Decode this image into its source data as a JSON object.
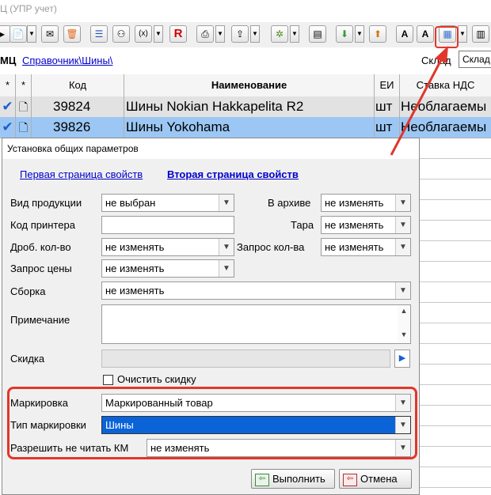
{
  "window": {
    "title": "Ц (УПР учет)"
  },
  "breadcrumb": {
    "lead": "МЦ",
    "path": "Справочник\\Шины\\"
  },
  "warehouse": {
    "label": "Склад",
    "value": "Склад"
  },
  "grid": {
    "headers": [
      "*",
      "*",
      "Код",
      "Наименование",
      "ЕИ",
      "Ставка НДС"
    ],
    "rows": [
      {
        "code": "39824",
        "name": "Шины Nokian Hakkapelita R2",
        "unit": "шт",
        "vat": "Необлагаемы"
      },
      {
        "code": "39826",
        "name": "Шины Yokohama",
        "unit": "шт",
        "vat": "Необлагаемы"
      }
    ]
  },
  "dialog": {
    "title": "Установка общих параметров",
    "tabs": [
      "Первая страница свойств",
      "Вторая страница свойств"
    ],
    "fields": {
      "product_type": {
        "label": "Вид продукции",
        "value": "не выбран"
      },
      "archive": {
        "label": "В архиве",
        "value": "не изменять"
      },
      "printer_code": {
        "label": "Код принтера",
        "value": ""
      },
      "tara": {
        "label": "Тара",
        "value": "не изменять"
      },
      "fractional_qty": {
        "label": "Дроб. кол-во",
        "value": "не изменять"
      },
      "ask_qty": {
        "label": "Запрос кол-ва",
        "value": "не изменять"
      },
      "ask_price": {
        "label": "Запрос цены",
        "value": "не изменять"
      },
      "assembly": {
        "label": "Сборка",
        "value": "не изменять"
      },
      "note": {
        "label": "Примечание",
        "value": ""
      },
      "discount": {
        "label": "Скидка",
        "value": ""
      },
      "clear_discount": {
        "label": "Очистить скидку",
        "checked": false
      },
      "marking": {
        "label": "Маркировка",
        "value": "Маркированный товар"
      },
      "marking_type": {
        "label": "Тип маркировки",
        "value": "Шины"
      },
      "allow_no_km": {
        "label": "Разрешить не читать КМ",
        "value": "не изменять"
      }
    },
    "buttons": {
      "execute": "Выполнить",
      "cancel": "Отмена"
    }
  },
  "colors": {
    "highlight": "#e2362b",
    "selected_row": "#9cc7f4",
    "selection": "#0a64d8",
    "link": "#0000cc"
  }
}
